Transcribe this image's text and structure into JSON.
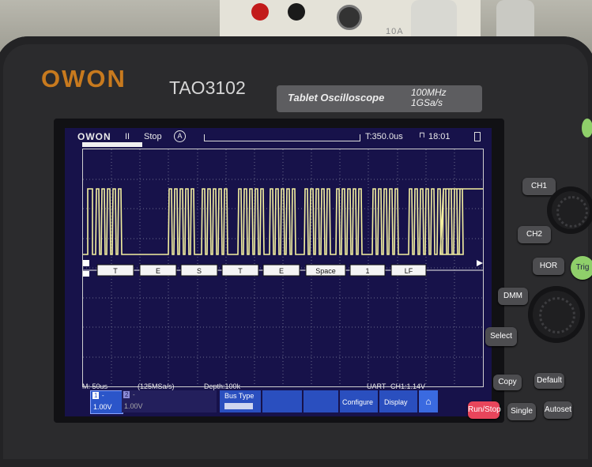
{
  "device": {
    "brand": "OWON",
    "model": "TAO3102",
    "description": "Tablet Oscilloscope",
    "bandwidth": "100MHz",
    "sample_rate": "1GSa/s"
  },
  "bench_label": "10A",
  "screen": {
    "logo": "OWON",
    "run_icon": "II",
    "status": "Stop",
    "trigger_mode": "A",
    "trigger_time": "T:350.0us",
    "clock": "18:01"
  },
  "decode": {
    "bytes": [
      "T",
      "E",
      "S",
      "T",
      "E",
      "Space",
      "1",
      "LF"
    ]
  },
  "timebase": {
    "scale": "M: 50us",
    "sample_rate": "(125MSa/s)",
    "depth": "Depth:100k"
  },
  "trigger_info": {
    "bus": "UART",
    "level": "CH1:1.14V"
  },
  "channels": [
    {
      "num": "1",
      "coupling": "-",
      "volts": "1.00V"
    },
    {
      "num": "2",
      "coupling": "-",
      "volts": "1.00V"
    }
  ],
  "menu": {
    "bus_type_label": "Bus Type",
    "configure": "Configure",
    "display": "Display"
  },
  "buttons": {
    "ch1": "CH1",
    "ch2": "CH2",
    "hor": "HOR",
    "trig": "Trig",
    "dmm": "DMM",
    "select": "Select",
    "copy": "Copy",
    "default": "Default",
    "run_stop": "Run/Stop",
    "single": "Single",
    "autoset": "Autoset"
  },
  "colors": {
    "screen_bg": "#17124a",
    "trace": "#f4f0a0",
    "accent_orange": "#c87a1e",
    "run_stop": "#e8455b"
  }
}
